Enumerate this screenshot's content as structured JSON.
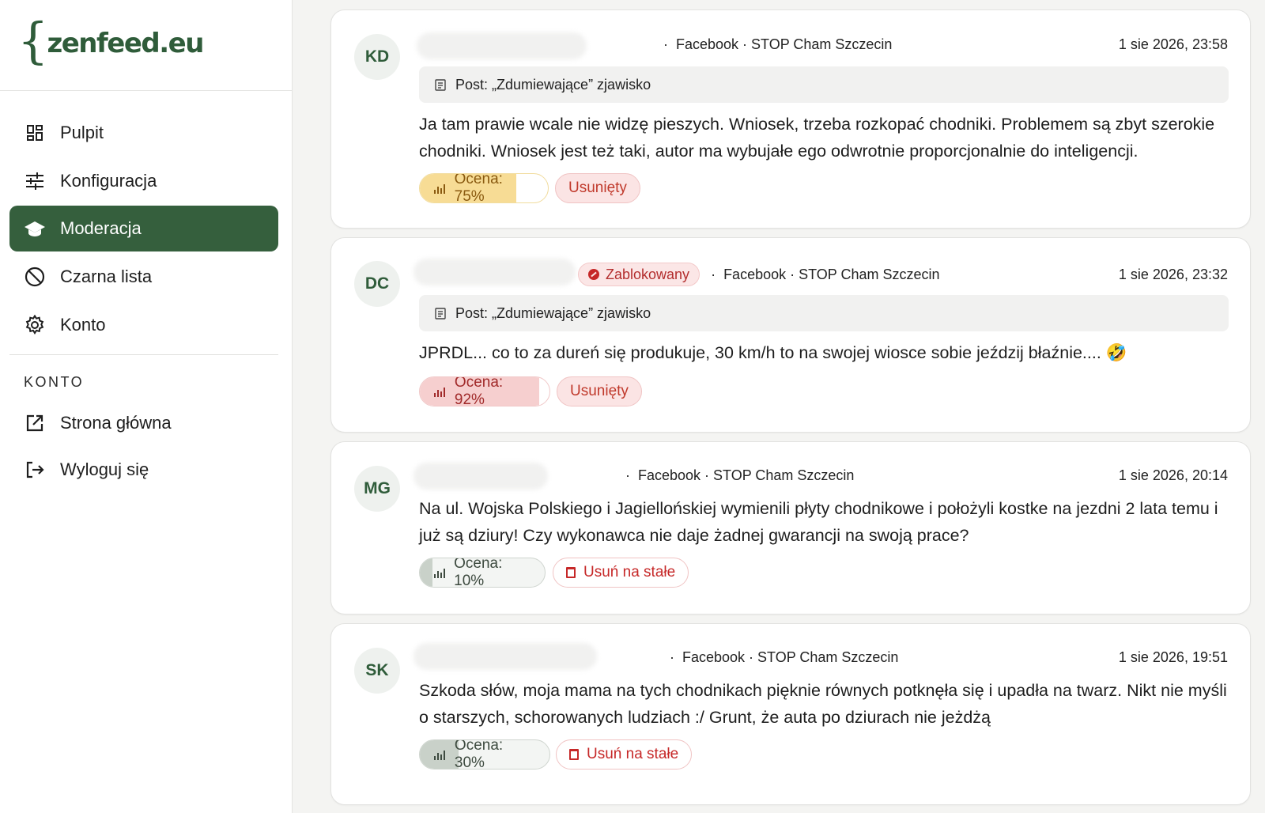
{
  "brand": {
    "logo_mark": "{",
    "logo_text": "zenfeed.eu"
  },
  "sidebar": {
    "items": [
      {
        "label": "Pulpit",
        "icon": "dashboard-icon"
      },
      {
        "label": "Konfiguracja",
        "icon": "sliders-icon"
      },
      {
        "label": "Moderacja",
        "icon": "graduation-cap-icon",
        "active": true
      },
      {
        "label": "Czarna lista",
        "icon": "ban-icon"
      },
      {
        "label": "Konto",
        "icon": "gear-icon"
      }
    ],
    "section_label": "KONTO",
    "section_items": [
      {
        "label": "Strona główna",
        "icon": "external-link-icon"
      },
      {
        "label": "Wyloguj się",
        "icon": "logout-icon"
      }
    ]
  },
  "comments": [
    {
      "initials": "KD",
      "blocked_label": "",
      "source": "Facebook · STOP Cham Szczecin",
      "timestamp": "1 sie 2026, 23:58",
      "post_ref": "Post: „Zdumiewające” zjawisko",
      "text": "Ja tam prawie wcale nie widzę pieszych. Wniosek, trzeba rozkopać chodniki. Problemem są zbyt szerokie chodniki. Wniosek jest też taki, autor ma wybujałe ego odwrotnie proporcjonalnie do inteligencji.",
      "score_label": "Ocena: 75%",
      "score": 0.75,
      "status_label": "Usunięty",
      "action_label": ""
    },
    {
      "initials": "DC",
      "blocked_label": "Zablokowany",
      "source": "Facebook · STOP Cham Szczecin",
      "timestamp": "1 sie 2026, 23:32",
      "post_ref": "Post: „Zdumiewające” zjawisko",
      "text": "JPRDL... co to za dureń się produkuje, 30 km/h to na swojej wiosce sobie jeździj błaźnie.... 🤣",
      "score_label": "Ocena: 92%",
      "score": 0.92,
      "status_label": "Usunięty",
      "action_label": ""
    },
    {
      "initials": "MG",
      "blocked_label": "",
      "source": "Facebook · STOP Cham Szczecin",
      "timestamp": "1 sie 2026, 20:14",
      "post_ref": "",
      "text": "Na ul. Wojska Polskiego i Jagiellońskiej wymienili płyty  chodnikowe i położyli  kostke na jezdni 2 lata temu i już są dziury! Czy wykonawca nie daje żadnej gwarancji na swoją prace?",
      "score_label": "Ocena: 10%",
      "score": 0.1,
      "status_label": "",
      "action_label": "Usuń na stałe"
    },
    {
      "initials": "SK",
      "blocked_label": "",
      "source": "Facebook · STOP Cham Szczecin",
      "timestamp": "1 sie 2026, 19:51",
      "post_ref": "",
      "text": "Szkoda słów, moja mama na tych chodnikach pięknie równych potknęła się i upadła na twarz. Nikt nie myśli o starszych, schorowanych ludziach :/ Grunt, że auta po dziurach nie jeżdżą",
      "score_label": "Ocena: 30%",
      "score": 0.3,
      "status_label": "",
      "action_label": "Usuń na stałe"
    }
  ],
  "colors": {
    "brand": "#2f5c3a",
    "active_nav": "#355f3d",
    "danger": "#c62828",
    "score_high": "#f4d28a",
    "score_very_high": "#f3c4c4",
    "score_low": "#d4d9d4"
  }
}
